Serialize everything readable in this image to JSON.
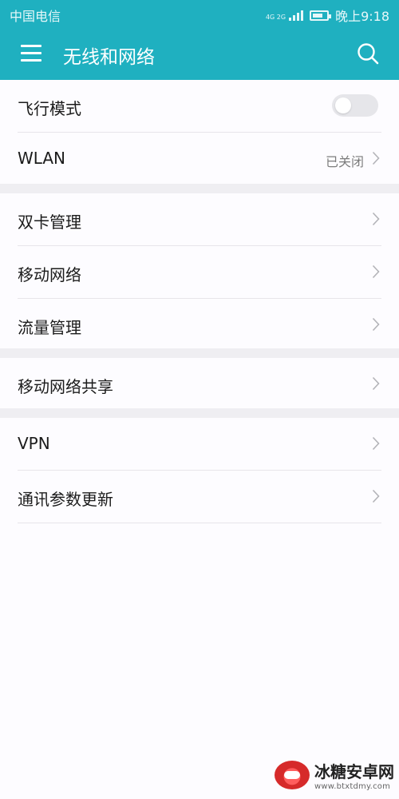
{
  "status_bar": {
    "carrier": "中国电信",
    "network_tag": "4G 2G",
    "time": "晚上9:18"
  },
  "app_bar": {
    "title": "无线和网络",
    "menu_icon": "hamburger-menu-icon",
    "search_icon": "search-icon"
  },
  "sections": [
    {
      "items": [
        {
          "label": "飞行模式",
          "type": "toggle",
          "checked": false
        },
        {
          "label": "WLAN",
          "value": "已关闭",
          "type": "chevron"
        }
      ]
    },
    {
      "items": [
        {
          "label": "双卡管理",
          "type": "chevron"
        },
        {
          "label": "移动网络",
          "type": "chevron"
        },
        {
          "label": "流量管理",
          "type": "chevron"
        }
      ]
    },
    {
      "items": [
        {
          "label": "移动网络共享",
          "type": "chevron"
        }
      ]
    },
    {
      "items": [
        {
          "label": "VPN",
          "type": "chevron"
        },
        {
          "label": "通讯参数更新",
          "type": "chevron"
        }
      ]
    }
  ],
  "watermark": {
    "name": "冰糖安卓网",
    "url": "www.btxtdmy.com"
  },
  "colors": {
    "accent": "#1fb0c0",
    "background": "#fbfafd",
    "divider_band": "#efeef2"
  }
}
